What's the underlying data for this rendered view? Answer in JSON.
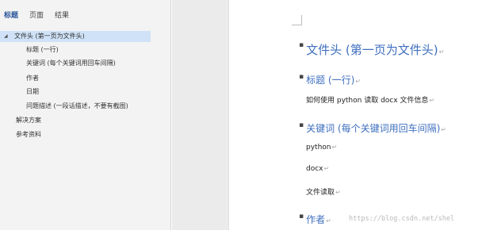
{
  "nav": {
    "tabs": [
      "标题",
      "页面",
      "结果"
    ],
    "items": [
      {
        "label": "文件头 (第一页为文件头)"
      },
      {
        "label": "标题 (一行)"
      },
      {
        "label": "关键词 (每个关键词用回车间隔)"
      },
      {
        "label": "作者"
      },
      {
        "label": "日期"
      },
      {
        "label": "问题描述 (一段话描述，不要有截图)"
      },
      {
        "label": "解决方案"
      },
      {
        "label": "参考资料"
      }
    ],
    "colors": {
      "active_tab": "#2b579a",
      "selected_row": "#cfe2f7"
    }
  },
  "doc": {
    "h1": "文件头 (第一页为文件头)",
    "h2_title": "标题 (一行)",
    "p_title": "如何使用 python 读取 docx 文件信息",
    "h2_keywords": "关键词 (每个关键词用回车间隔)",
    "kw1": "python",
    "kw2": "docx",
    "kw3": "文件读取",
    "h2_author": "作者",
    "para_mark": "↵",
    "heading_color": "#3f6fbf"
  },
  "watermark": "https://blog.csdn.net/shel"
}
